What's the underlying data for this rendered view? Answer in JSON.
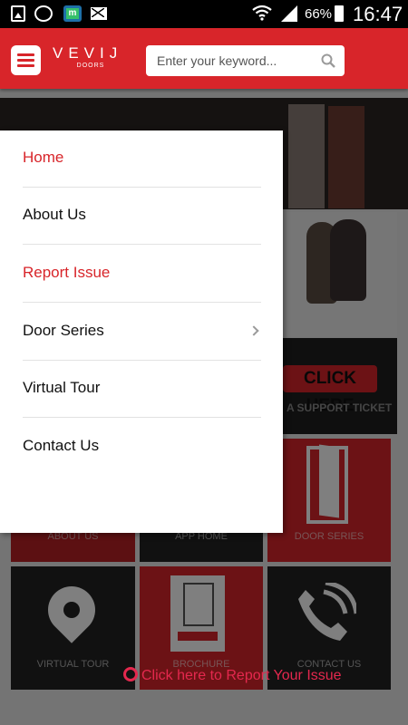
{
  "statusbar": {
    "battery": "66%",
    "time": "16:47",
    "app_badge": "m",
    "icons": [
      "gallery-icon",
      "whatsapp-icon",
      "app-icon",
      "mail-icon",
      "wifi-icon",
      "signal-icon",
      "battery-icon"
    ]
  },
  "header": {
    "brand_main": "VEVIJ",
    "brand_sub": "DOORS",
    "search_placeholder": "Enter your keyword...",
    "search_value": "",
    "color": "#d8252a"
  },
  "background": {
    "support_button": "CLICK HERE",
    "support_text": "A SUPPORT TICKET",
    "tiles": {
      "about": "ABOUT US",
      "app_home": "APP HOME",
      "door_series": "DOOR SERIES",
      "virtual_tour": "VIRTUAL TOUR",
      "brochure": "BROCHURE",
      "contact": "CONTACT US"
    },
    "report_link": "Click here to Report Your Issue"
  },
  "drawer": {
    "items": [
      {
        "label": "Home",
        "active": true
      },
      {
        "label": "About Us"
      },
      {
        "label": "Report Issue",
        "highlight": true
      },
      {
        "label": "Door Series",
        "has_submenu": true
      },
      {
        "label": "Virtual Tour"
      },
      {
        "label": "Contact Us"
      }
    ]
  }
}
